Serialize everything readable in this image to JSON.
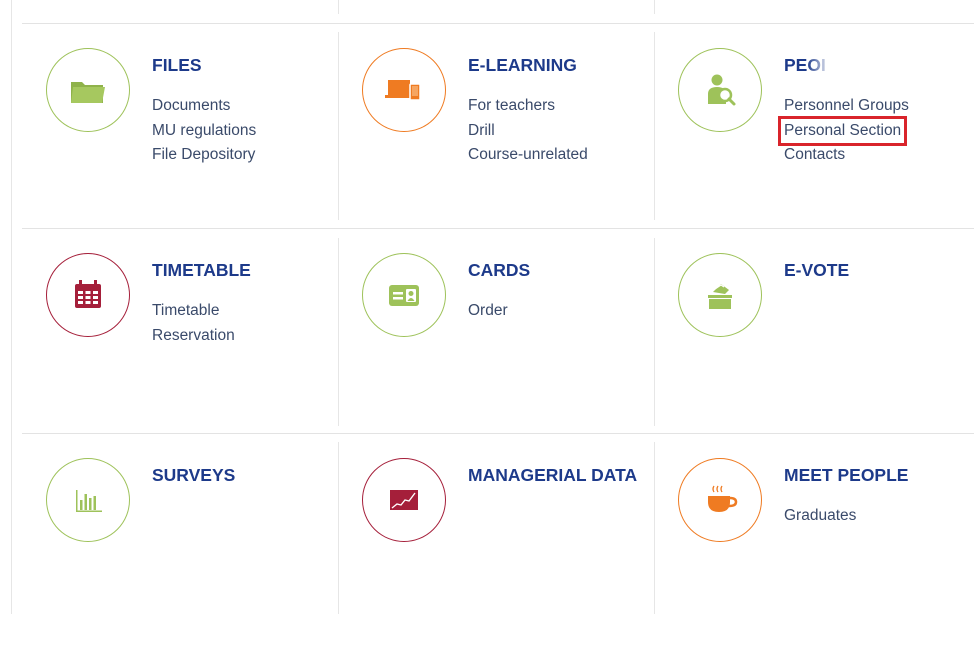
{
  "tiles": [
    {
      "title": "FILES",
      "icon": "folder-icon",
      "color": "#9ec25a",
      "links": [
        "Documents",
        "MU regulations",
        "File Depository"
      ]
    },
    {
      "title": "E-LEARNING",
      "icon": "devices-icon",
      "color": "#ef7b22",
      "links": [
        "For teachers",
        "Drill",
        "Course-unrelated"
      ]
    },
    {
      "title": "PEOI",
      "icon": "person-search-icon",
      "color": "#9ec25a",
      "links": [
        "Personnel Groups",
        "Personal Section",
        "Contacts"
      ]
    },
    {
      "title": "TIMETABLE",
      "icon": "calendar-icon",
      "color": "#a51f3a",
      "links": [
        "Timetable",
        "Reservation"
      ]
    },
    {
      "title": "CARDS",
      "icon": "id-card-icon",
      "color": "#9ec25a",
      "links": [
        "Order"
      ]
    },
    {
      "title": "E-VOTE",
      "icon": "ballot-box-icon",
      "color": "#9ec25a",
      "links": []
    },
    {
      "title": "SURVEYS",
      "icon": "bar-chart-icon",
      "color": "#9ec25a",
      "links": []
    },
    {
      "title": "MANAGERIAL DATA",
      "icon": "trend-chart-icon",
      "color": "#a51f3a",
      "links": []
    },
    {
      "title": "MEET PEOPLE",
      "icon": "coffee-cup-icon",
      "color": "#ef7b22",
      "links": [
        "Graduates"
      ]
    }
  ],
  "highlight": {
    "tile": "PEOI",
    "link": "Personal Section",
    "color": "#d9242b"
  }
}
